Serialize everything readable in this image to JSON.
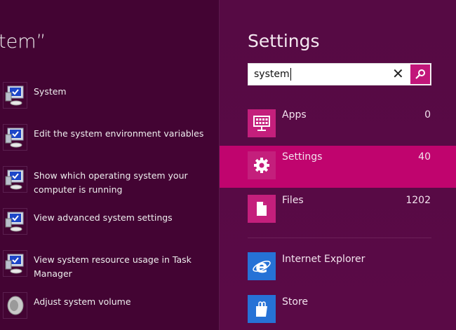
{
  "results_title": "tem”",
  "results": [
    {
      "label": "System",
      "icon": "system-computer-icon"
    },
    {
      "label": "Edit the system environment variables",
      "icon": "system-computer-icon"
    },
    {
      "label": "Show which operating system your computer is running",
      "icon": "system-computer-icon"
    },
    {
      "label": "View advanced system settings",
      "icon": "system-computer-icon"
    },
    {
      "label": "View system resource usage in Task Manager",
      "icon": "system-computer-icon"
    },
    {
      "label": "Adjust system volume",
      "icon": "speaker-icon"
    }
  ],
  "pane": {
    "title": "Settings",
    "search_value": "system",
    "clear_glyph": "✕",
    "categories": [
      {
        "label": "Apps",
        "count": "0",
        "icon": "apps-icon"
      },
      {
        "label": "Settings",
        "count": "40",
        "icon": "gear-icon"
      },
      {
        "label": "Files",
        "count": "1202",
        "icon": "file-icon"
      }
    ],
    "apps": [
      {
        "label": "Internet Explorer",
        "icon": "internet-explorer-icon"
      },
      {
        "label": "Store",
        "icon": "store-icon"
      }
    ]
  },
  "colors": {
    "accent": "#c0046e",
    "tile": "#c41f7c",
    "app_tile": "#2672d6",
    "background": "#430433"
  }
}
